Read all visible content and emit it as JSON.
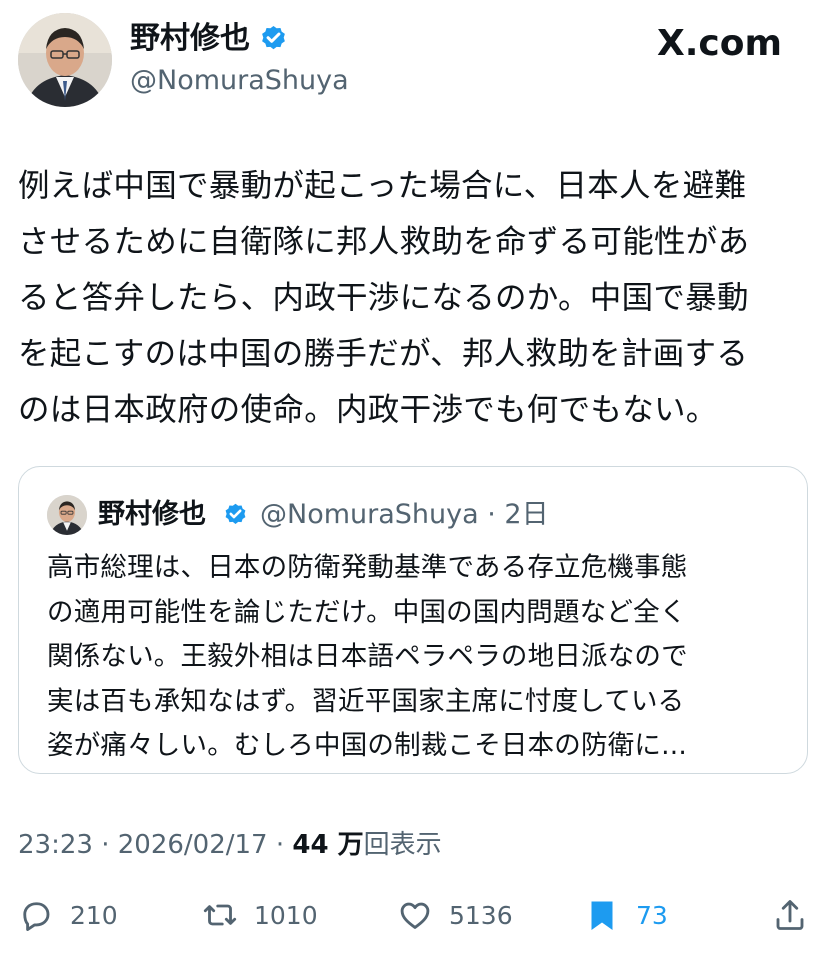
{
  "header": {
    "author_name": "野村修也",
    "author_handle": "@NomuraShuya",
    "brand": "X.com"
  },
  "tweet": {
    "text": "例えば中国で暴動が起こった場合に、日本人を避難\nさせるために自衛隊に邦人救助を命ずる可能性があ\nると答弁したら、内政干渉になるのか。中国で暴動\nを起こすのは中国の勝手だが、邦人救助を計画する\nのは日本政府の使命。内政干渉でも何でもない。"
  },
  "quoted": {
    "author_name": "野村修也",
    "author_handle": "@NomuraShuya",
    "age": "2日",
    "text": "高市総理は、日本の防衛発動基準である存立危機事態\nの適用可能性を論じただけ。中国の国内問題など全く\n関係ない。王毅外相は日本語ペラペラの地日派なので\n実は百も承知なはず。習近平国家主席に忖度している\n姿が痛々しい。むしろ中国の制裁こそ日本の防衛に..."
  },
  "meta": {
    "time": "23:23",
    "date": "2026/02/17",
    "views_count": "44 万",
    "views_label": "回表示"
  },
  "actions": {
    "replies": "210",
    "reposts": "1010",
    "likes": "5136",
    "bookmarks": "73"
  },
  "colors": {
    "accent": "#1d9bf0",
    "secondary_text": "#536471",
    "border": "#cfd9de"
  },
  "icons": [
    "verified-badge-icon",
    "reply-icon",
    "repost-icon",
    "like-icon",
    "bookmark-icon",
    "share-icon"
  ]
}
